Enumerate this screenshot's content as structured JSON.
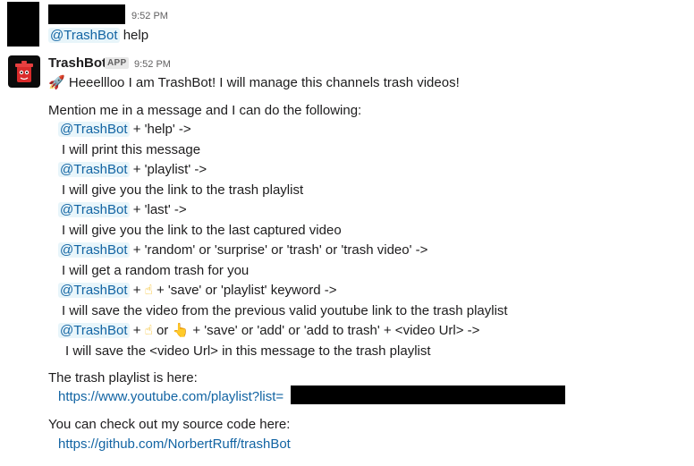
{
  "first_message": {
    "time": "9:52 PM",
    "mention": "@TrashBot",
    "text": " help"
  },
  "bot_message": {
    "sender": "TrashBot",
    "badge": "APP",
    "time": "9:52 PM",
    "greeting_emoji": "🚀",
    "greeting": "Heeellloo I am TrashBot! I will manage this channels trash videos!",
    "intro": "Mention me in a message and I can do the following:",
    "mention": "@TrashBot",
    "commands": [
      {
        "cmd": " + 'help' ->",
        "desc": "I will print this message"
      },
      {
        "cmd": " + 'playlist' ->",
        "desc": "I will give you the link to the trash playlist"
      },
      {
        "cmd": " + 'last' ->",
        "desc": "I will give you the link to the last captured video"
      },
      {
        "cmd": " + 'random' or 'surprise' or 'trash' or 'trash video' ->",
        "desc": "I will get a random trash for you"
      }
    ],
    "save_cmd": {
      "emoji": "☝",
      "rest": " + 'save' or 'playlist' keyword ->",
      "desc": "I will save the video from the previous valid youtube link to the trash playlist"
    },
    "add_cmd": {
      "emoji1": "☝",
      "or": " or ",
      "emoji2": "👆",
      "rest": " + 'save' or 'add' or 'add to trash' + <video Url> ->",
      "desc": "I will save the <video Url> in this message to the trash playlist"
    },
    "playlist_label": "The trash playlist is here:",
    "playlist_link": "https://www.youtube.com/playlist?list=",
    "source_label": "You can check out my source code here:",
    "source_link": "https://github.com/NorbertRuff/trashBot"
  }
}
